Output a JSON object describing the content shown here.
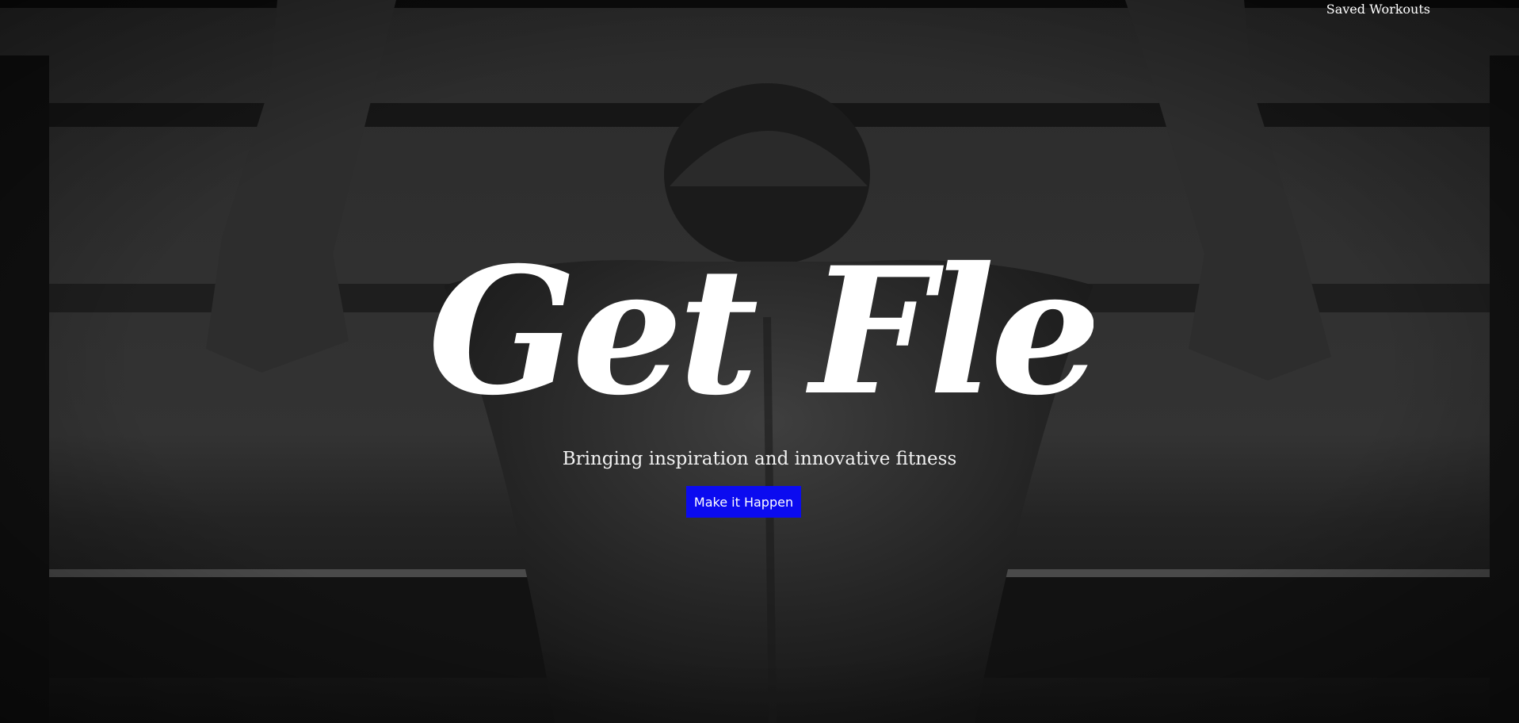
{
  "nav": {
    "saved_workouts_label": "Saved Workouts"
  },
  "hero": {
    "title": "Get Flexed",
    "tagline": "Bringing inspiration and innovative fitness",
    "cta_label": "Make it Happen"
  },
  "colors": {
    "cta_background": "#0b0bf0",
    "text": "#ffffff",
    "background": "#262626"
  },
  "icons": {
    "background_image": "gym-pullup-photo"
  }
}
